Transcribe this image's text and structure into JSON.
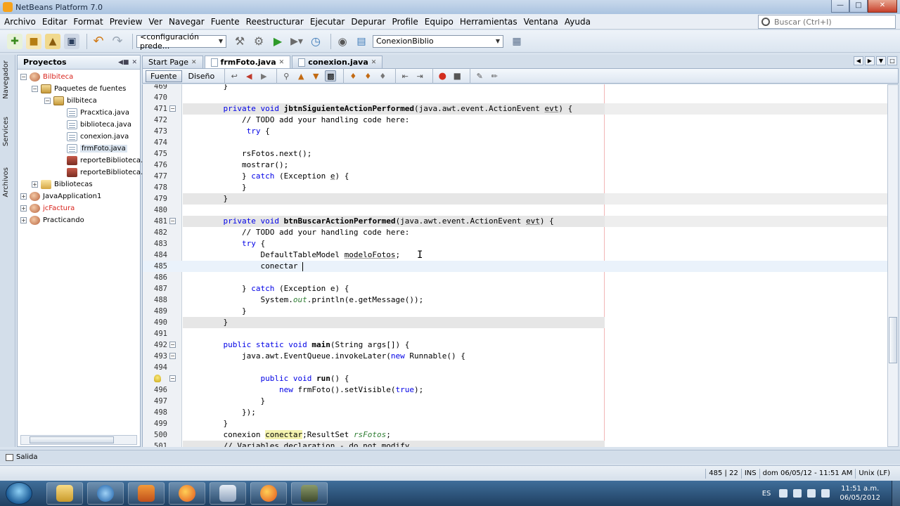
{
  "window": {
    "title": "NetBeans Platform 7.0"
  },
  "menu": [
    "Archivo",
    "Editar",
    "Format",
    "Preview",
    "Ver",
    "Navegar",
    "Fuente",
    "Reestructurar",
    "Ejecutar",
    "Depurar",
    "Profile",
    "Equipo",
    "Herramientas",
    "Ventana",
    "Ayuda"
  ],
  "search": {
    "placeholder": "Buscar (Ctrl+I)"
  },
  "toolbar": {
    "config_select": "<configuración prede...",
    "project_select": "ConexionBiblio"
  },
  "side_tabs": [
    "Navegador",
    "Services",
    "Archivos"
  ],
  "projects": {
    "title": "Proyectos",
    "items": [
      {
        "label": "Bilbiteca"
      },
      {
        "label": "Paquetes de fuentes"
      },
      {
        "label": "bilbiteca"
      },
      {
        "label": "Pracxtica.java"
      },
      {
        "label": "biblioteca.java"
      },
      {
        "label": "conexion.java"
      },
      {
        "label": "frmFoto.java"
      },
      {
        "label": "reporteBiblioteca."
      },
      {
        "label": "reporteBiblioteca."
      },
      {
        "label": "Bibliotecas"
      },
      {
        "label": "JavaApplication1"
      },
      {
        "label": "jcFactura"
      },
      {
        "label": "Practicando"
      }
    ]
  },
  "editor": {
    "tabs": [
      {
        "label": "Start Page"
      },
      {
        "label": "frmFoto.java"
      },
      {
        "label": "conexion.java"
      }
    ],
    "views": {
      "source": "Fuente",
      "design": "Diseño"
    },
    "lines": [
      {
        "n": "469",
        "t": "    }"
      },
      {
        "n": "470",
        "t": ""
      },
      {
        "n": "471",
        "t": "    private void jbtnSiguienteActionPerformed(java.awt.event.ActionEvent evt) {"
      },
      {
        "n": "472",
        "t": "        // TODO add your handling code here:"
      },
      {
        "n": "473",
        "t": "         try {"
      },
      {
        "n": "474",
        "t": ""
      },
      {
        "n": "475",
        "t": "        rsFotos.next();"
      },
      {
        "n": "476",
        "t": "        mostrar();"
      },
      {
        "n": "477",
        "t": "        } catch (Exception e) {"
      },
      {
        "n": "478",
        "t": "        }"
      },
      {
        "n": "479",
        "t": "    }"
      },
      {
        "n": "480",
        "t": ""
      },
      {
        "n": "481",
        "t": "    private void btnBuscarActionPerformed(java.awt.event.ActionEvent evt) {"
      },
      {
        "n": "482",
        "t": "        // TODO add your handling code here:"
      },
      {
        "n": "483",
        "t": "        try {"
      },
      {
        "n": "484",
        "t": "            DefaultTableModel modeloFotos;"
      },
      {
        "n": "485",
        "t": "            conectar "
      },
      {
        "n": "486",
        "t": ""
      },
      {
        "n": "487",
        "t": "        } catch (Exception e) {"
      },
      {
        "n": "488",
        "t": "            System.out.println(e.getMessage());"
      },
      {
        "n": "489",
        "t": "        }"
      },
      {
        "n": "490",
        "t": "    }"
      },
      {
        "n": "491",
        "t": ""
      },
      {
        "n": "492",
        "t": "    public static void main(String args[]) {"
      },
      {
        "n": "493",
        "t": "        java.awt.EventQueue.invokeLater(new Runnable() {"
      },
      {
        "n": "494",
        "t": ""
      },
      {
        "n": "495",
        "t": "            public void run() {"
      },
      {
        "n": "496",
        "t": "                new frmFoto().setVisible(true);"
      },
      {
        "n": "497",
        "t": "            }"
      },
      {
        "n": "498",
        "t": "        });"
      },
      {
        "n": "499",
        "t": "    }"
      },
      {
        "n": "500",
        "t": "    conexion conectar;ResultSet rsFotos;"
      },
      {
        "n": "501",
        "t": "    // Variables declaration - do not modify"
      }
    ]
  },
  "output": {
    "label": "Salida"
  },
  "status": {
    "position": "485 | 22",
    "mode": "INS",
    "date": "dom 06/05/12 - 11:51 AM",
    "eol": "Unix (LF)"
  },
  "taskbar": {
    "lang": "ES",
    "time": "11:51 a.m.",
    "date": "06/05/2012"
  }
}
